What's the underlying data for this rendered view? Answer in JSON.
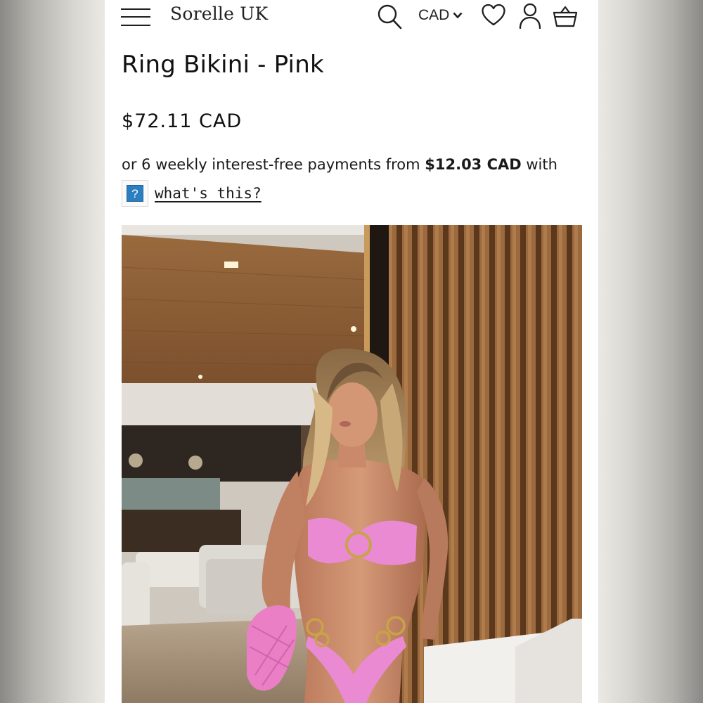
{
  "header": {
    "brand": "Sorelle UK",
    "currency": "CAD",
    "icons": [
      "menu-icon",
      "search-icon",
      "chevron-down-icon",
      "heart-icon",
      "user-icon",
      "basket-icon"
    ]
  },
  "product": {
    "title": "Ring Bikini - Pink",
    "price": "$72.11 CAD",
    "installments": {
      "prefix": "or 6 weekly interest-free payments from ",
      "amount": "$12.03 CAD",
      "suffix": " with"
    },
    "help_badge": "?",
    "whats_this": "what's this?"
  },
  "colors": {
    "bikini": "#e98ad2",
    "gold_ring": "#c9a347",
    "wood": "#8a5a33",
    "help_badge": "#2a7fc1"
  }
}
